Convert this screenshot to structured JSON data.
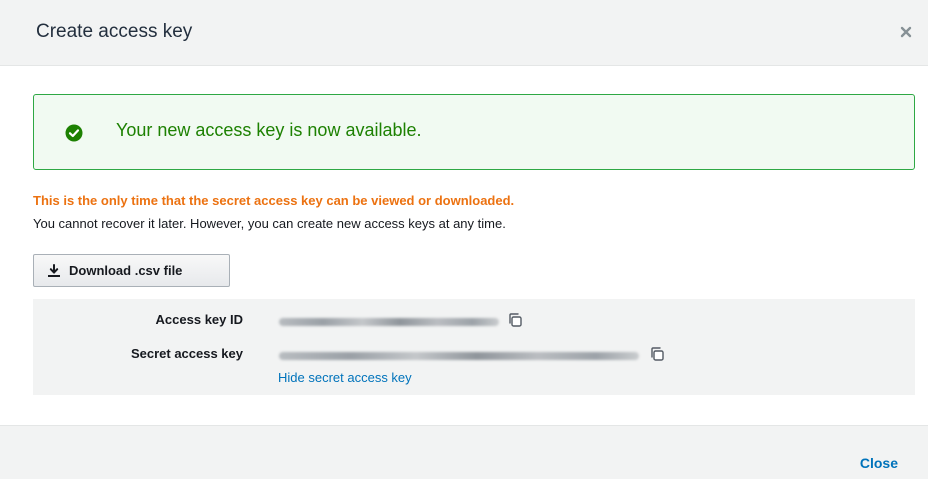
{
  "dialog": {
    "title": "Create access key",
    "close_icon": "close-x-icon"
  },
  "alert": {
    "icon": "check-circle-icon",
    "message": "Your new access key is now available.",
    "color": "#1d8102",
    "border_color": "#2ea844"
  },
  "warning": {
    "headline": "This is the only time that the secret access key can be viewed or downloaded.",
    "detail": "You cannot recover it later. However, you can create new access keys at any time.",
    "color": "#ec7211"
  },
  "download_button": {
    "icon": "download-icon",
    "label": "Download .csv file"
  },
  "keys": {
    "access_key_id_label": "Access key ID",
    "secret_access_key_label": "Secret access key",
    "copy_icon": "copy-icon",
    "hide_secret_label": "Hide secret access key"
  },
  "footer": {
    "close_label": "Close",
    "link_color": "#0073bb"
  }
}
